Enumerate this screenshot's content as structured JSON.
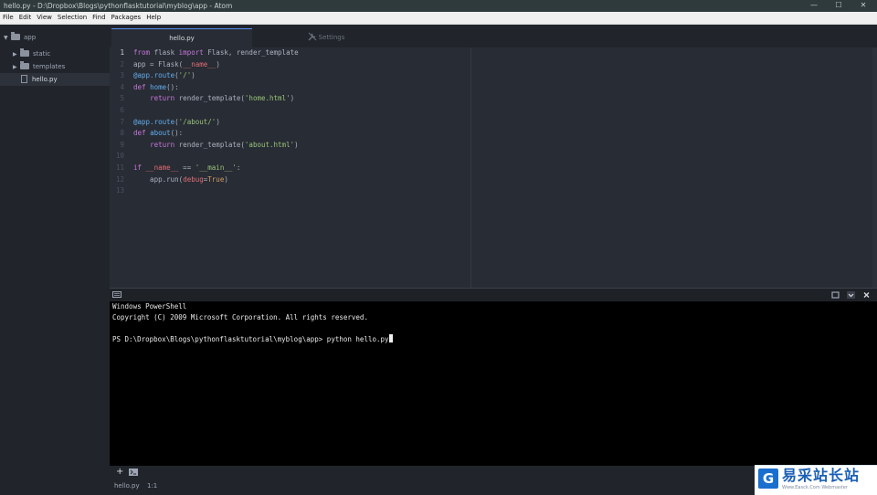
{
  "window": {
    "title": "hello.py - D:\\Dropbox\\Blogs\\pythonflasktutorial\\myblog\\app - Atom",
    "controls": [
      "—",
      "☐",
      "✕"
    ]
  },
  "menu": [
    "File",
    "Edit",
    "View",
    "Selection",
    "Find",
    "Packages",
    "Help"
  ],
  "tree": {
    "root": "app",
    "folders": [
      "static",
      "templates"
    ],
    "files": [
      "hello.py"
    ]
  },
  "tabs": [
    {
      "label": "hello.py",
      "active": true
    },
    {
      "label": "Settings",
      "icon": "tools-icon",
      "active": false
    }
  ],
  "editor": {
    "active_line": 1,
    "lines": [
      [
        {
          "t": "from",
          "c": "kw"
        },
        {
          "t": " flask "
        },
        {
          "t": "import",
          "c": "kw"
        },
        {
          "t": " Flask, render_template"
        }
      ],
      [
        {
          "t": "app = Flask("
        },
        {
          "t": "__name__",
          "c": "dn"
        },
        {
          "t": ")"
        }
      ],
      [
        {
          "t": "@app.route",
          "c": "fn"
        },
        {
          "t": "("
        },
        {
          "t": "'/'",
          "c": "st"
        },
        {
          "t": ")"
        }
      ],
      [
        {
          "t": "def",
          "c": "kw"
        },
        {
          "t": " "
        },
        {
          "t": "home",
          "c": "fn"
        },
        {
          "t": "():"
        }
      ],
      [
        {
          "t": "    "
        },
        {
          "t": "return",
          "c": "kw"
        },
        {
          "t": " render_template("
        },
        {
          "t": "'home.html'",
          "c": "st"
        },
        {
          "t": ")"
        }
      ],
      [],
      [
        {
          "t": "@app.route",
          "c": "fn"
        },
        {
          "t": "("
        },
        {
          "t": "'/about/'",
          "c": "st"
        },
        {
          "t": ")"
        }
      ],
      [
        {
          "t": "def",
          "c": "kw"
        },
        {
          "t": " "
        },
        {
          "t": "about",
          "c": "fn"
        },
        {
          "t": "():"
        }
      ],
      [
        {
          "t": "    "
        },
        {
          "t": "return",
          "c": "kw"
        },
        {
          "t": " render_template("
        },
        {
          "t": "'about.html'",
          "c": "st"
        },
        {
          "t": ")"
        }
      ],
      [],
      [
        {
          "t": "if",
          "c": "kw"
        },
        {
          "t": " "
        },
        {
          "t": "__name__",
          "c": "dn"
        },
        {
          "t": " == "
        },
        {
          "t": "'__main__'",
          "c": "st"
        },
        {
          "t": ":"
        }
      ],
      [
        {
          "t": "    app.run("
        },
        {
          "t": "debug",
          "c": "dn"
        },
        {
          "t": "="
        },
        {
          "t": "True",
          "c": "cs"
        },
        {
          "t": ")"
        }
      ],
      []
    ]
  },
  "terminal": {
    "lines": [
      "Windows PowerShell",
      "Copyright (C) 2009 Microsoft Corporation. All rights reserved.",
      "",
      "PS D:\\Dropbox\\Blogs\\pythonflasktutorial\\myblog\\app> python hello.py"
    ],
    "header_icons": [
      "maximize-icon",
      "chevron-down-icon",
      "close-icon"
    ]
  },
  "terminal_tabs": {
    "add": "+",
    "icon": "terminal-icon"
  },
  "status": {
    "file": "hello.py",
    "cursor": "1:1"
  },
  "watermark": {
    "logo": "G",
    "text": "易采站长站",
    "sub": "Www.Easck.Com Webmaster"
  }
}
